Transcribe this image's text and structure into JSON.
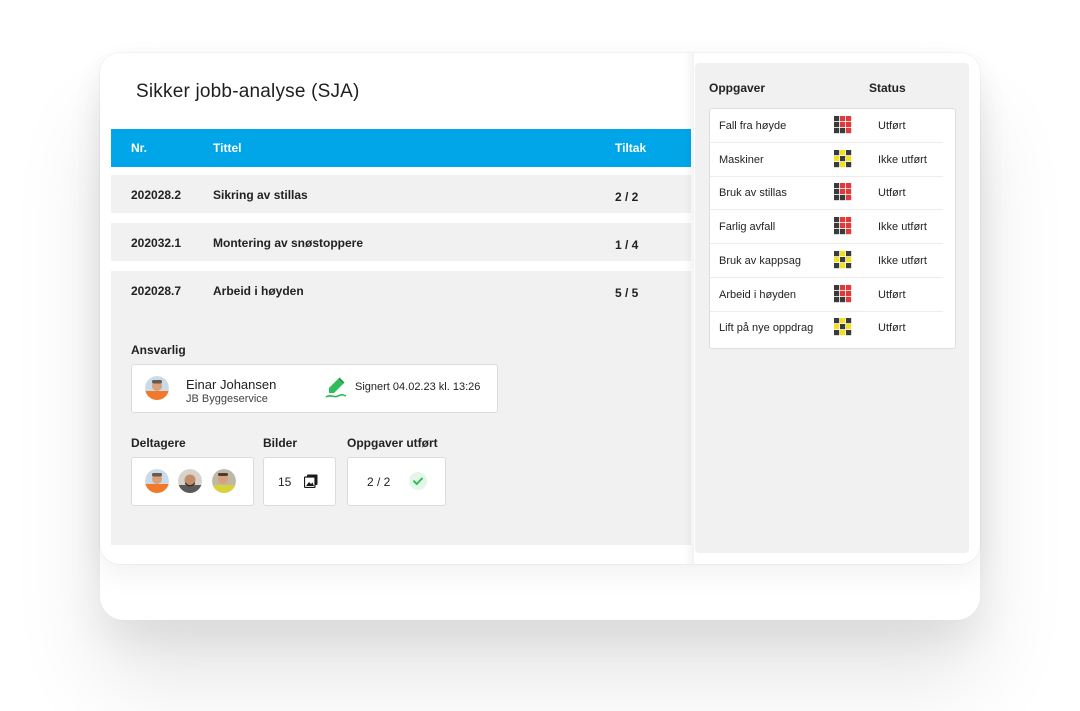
{
  "page_title": "Sikker jobb-analyse (SJA)",
  "table": {
    "headers": {
      "nr": "Nr.",
      "title": "Tittel",
      "tiltak": "Tiltak"
    },
    "rows": [
      {
        "nr": "202028.2",
        "title": "Sikring av stillas",
        "tiltak": "2 / 2"
      },
      {
        "nr": "202032.1",
        "title": "Montering av snøstoppere",
        "tiltak": "1 / 4"
      },
      {
        "nr": "202028.7",
        "title": "Arbeid i høyden",
        "tiltak": "5 / 5"
      }
    ]
  },
  "details": {
    "responsible_label": "Ansvarlig",
    "responsible": {
      "name": "Einar Johansen",
      "company": "JB Byggeservice",
      "signed": "Signert 04.02.23 kl. 13:26",
      "sign_icon": "pencil-icon"
    },
    "participants_label": "Deltagere",
    "images_label": "Bilder",
    "images_count": "15",
    "images_icon": "image-icon",
    "tasks_done_label": "Oppgaver utført",
    "tasks_done_value": "2 / 2",
    "tasks_done_icon": "check-icon"
  },
  "tasks_panel": {
    "headers": {
      "task": "Oppgaver",
      "status": "Status"
    },
    "items": [
      {
        "name": "Fall fra høyde",
        "risk": "red",
        "status": "Utført"
      },
      {
        "name": "Maskiner",
        "risk": "yellow",
        "status": "Ikke utført"
      },
      {
        "name": "Bruk av stillas",
        "risk": "red",
        "status": "Utført"
      },
      {
        "name": "Farlig avfall",
        "risk": "red",
        "status": "Ikke utført"
      },
      {
        "name": "Bruk av kappsag",
        "risk": "yellow",
        "status": "Ikke utført"
      },
      {
        "name": "Arbeid i høyden",
        "risk": "red",
        "status": "Utført"
      },
      {
        "name": "Lift på nye oppdrag",
        "risk": "yellow",
        "status": "Utført"
      }
    ]
  },
  "colors": {
    "header_blue": "#00a6e8",
    "risk_red": "#e03a3a",
    "risk_yellow": "#f2e21a",
    "risk_dark": "#3a3a3a",
    "check_green": "#2ebd59"
  }
}
